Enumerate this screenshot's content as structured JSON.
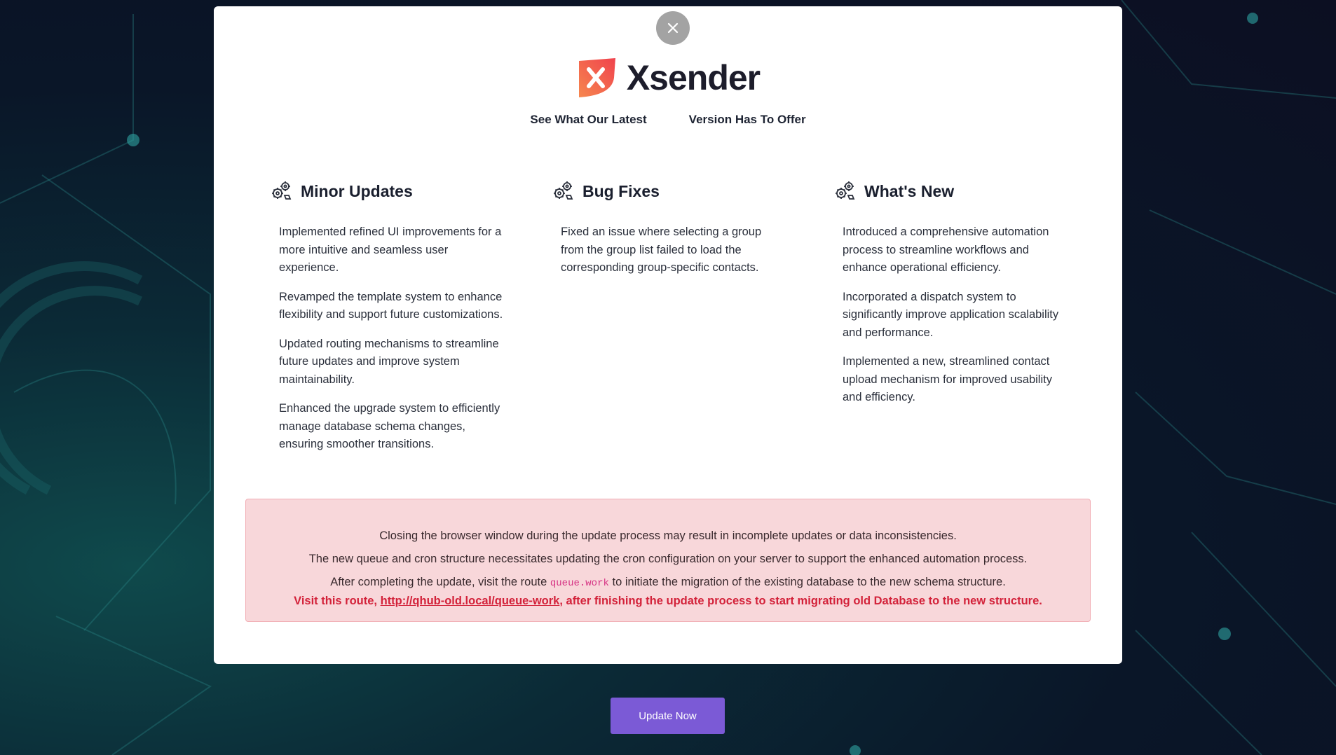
{
  "brand": {
    "name": "Xsender",
    "tagline_part1": "See What Our Latest",
    "tagline_part2": "Version Has To Offer"
  },
  "columns": [
    {
      "title": "Minor Updates",
      "icon": "gears-icon",
      "items": [
        "Implemented refined UI improvements for a more intuitive and seamless user experience.",
        "Revamped the template system to enhance flexibility and support future customizations.",
        "Updated routing mechanisms to streamline future updates and improve system maintainability.",
        "Enhanced the upgrade system to efficiently manage database schema changes, ensuring smoother transitions."
      ]
    },
    {
      "title": "Bug Fixes",
      "icon": "gears-icon",
      "items": [
        "Fixed an issue where selecting a group from the group list failed to load the corresponding group-specific contacts."
      ]
    },
    {
      "title": "What's New",
      "icon": "gears-icon",
      "items": [
        "Introduced a comprehensive automation process to streamline workflows and enhance operational efficiency.",
        "Incorporated a dispatch system to significantly improve application scalability and performance.",
        "Implemented a new, streamlined contact upload mechanism for improved usability and efficiency."
      ]
    }
  ],
  "alert": {
    "line1": "Closing the browser window during the update process may result in incomplete updates or data inconsistencies.",
    "line2": "The new queue and cron structure necessitates updating the cron configuration on your server to support the enhanced automation process.",
    "line3_before": "After completing the update, visit the route",
    "line3_code": "queue.work",
    "line3_after": "to initiate the migration of the existing database to the new schema structure.",
    "warn_before": "Visit this route,",
    "warn_link": "http://qhub-old.local/queue-work",
    "warn_after": ", after finishing the update process to start migrating old Database to the new structure."
  },
  "actions": {
    "update_label": "Update Now"
  },
  "colors": {
    "accent": "#7b5ad6",
    "alert_bg": "#f8d7da",
    "warn_text": "#d3223a",
    "logo_red": "#f0424d",
    "logo_orange": "#f6874f"
  }
}
